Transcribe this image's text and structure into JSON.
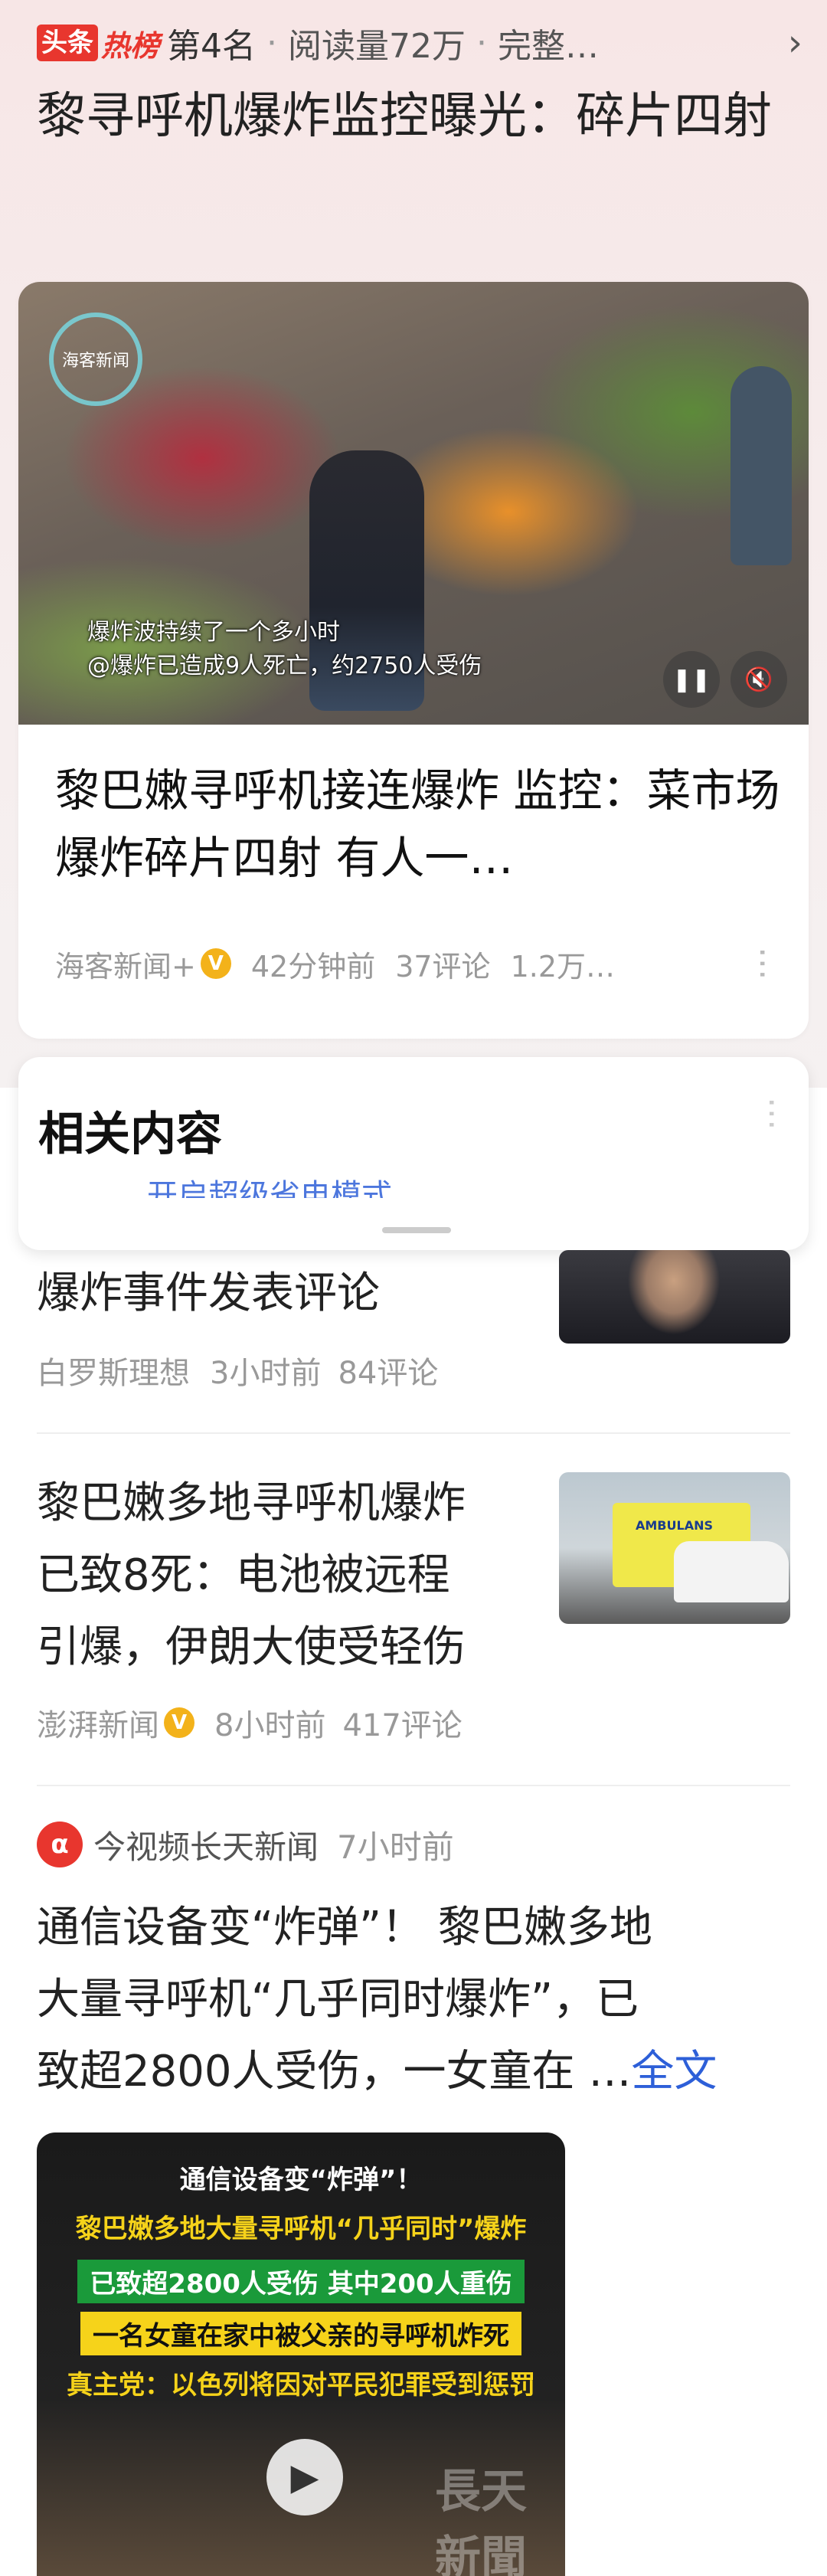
{
  "hotbar": {
    "brand_a": "头条",
    "brand_b": "热榜",
    "rank": "第4名",
    "reads": "阅读量72万",
    "complete": "完整…",
    "chevron": "chevron-right-icon"
  },
  "headline": "黎寻呼机爆炸监控曝光：碎片四射",
  "video": {
    "logo_text": "海客新闻",
    "caption_1": "爆炸波持续了一个多小时",
    "caption_2": "@爆炸已造成9人死亡，约2750人受伤",
    "pause_icon": "pause-icon",
    "mute_icon": "mute-icon"
  },
  "card": {
    "title": "黎巴嫩寻呼机接连爆炸 监控：菜市场爆炸碎片四射 有人一…",
    "source": "海客新闻+",
    "verified": "V",
    "time": "42分钟前",
    "comments": "37评论",
    "views": "1.2万…",
    "more": "⋮"
  },
  "related": {
    "title": "相关内容",
    "more": "⋮",
    "peek_text": "开启超级省电模式"
  },
  "articles": [
    {
      "title": "爆炸事件发表评论",
      "source": "白罗斯理想",
      "time": "3小时前",
      "comments": "84评论"
    },
    {
      "title_line_1": "黎巴嫩多地寻呼机爆炸",
      "title_line_2": "已致8死：电池被远程",
      "title_line_3": "引爆，伊朗大使受轻伤",
      "source": "澎湃新闻",
      "verified": "V",
      "time": "8小时前",
      "comments": "417评论",
      "thumb_label": "AMBULANS"
    }
  ],
  "post": {
    "source_logo": "α",
    "source": "今视频长天新闻",
    "time": "7小时前",
    "line_1": "通信设备变“炸弹”！ 黎巴嫩多地",
    "line_2": "大量寻呼机“几乎同时爆炸”，已",
    "line_3": "致超2800人受伤，一女童在 …",
    "fulltext": "全文",
    "media": {
      "l1": "通信设备变“炸弹”！",
      "l2": "黎巴嫩多地大量寻呼机“几乎同时”爆炸",
      "l3": "已致超2800人受伤 其中200人重伤",
      "l4": "一名女童在家中被父亲的寻呼机炸死",
      "l5": "真主党：以色列将因对平民犯罪受到惩罚",
      "watermark": "長天新聞",
      "play_icon": "play-icon"
    }
  },
  "colors": {
    "brand_red": "#e8362e",
    "link_blue": "#2d5fd8",
    "verified_gold": "#f3b21a",
    "meta_gray": "#999999"
  }
}
